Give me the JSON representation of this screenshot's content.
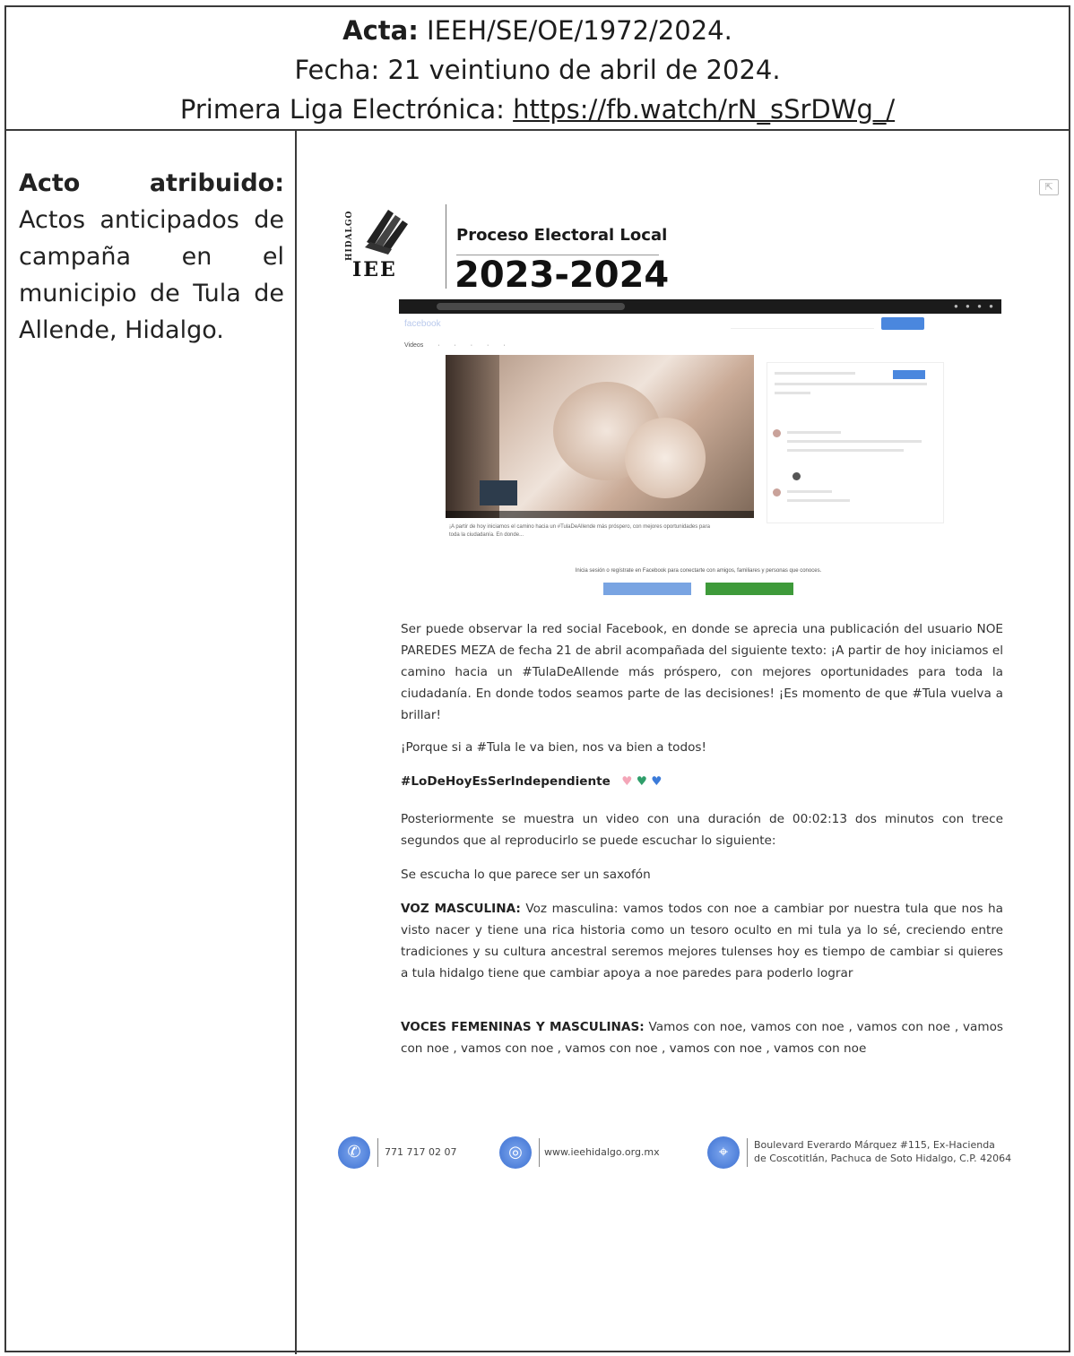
{
  "header": {
    "acta_label": "Acta:",
    "acta_value": "IEEH/SE/OE/1972/2024.",
    "fecha": "Fecha: 21 veintiuno de abril de 2024.",
    "liga_label": "Primera Liga Electrónica:",
    "liga_url": "https://fb.watch/rN_sSrDWg_/"
  },
  "left": {
    "label_word1": "Acto",
    "label_word2": "atribuido:",
    "description": "Actos anticipados de campaña en el municipio de Tula de Allende, Hidalgo."
  },
  "letterhead": {
    "logo_vertical": "HIDALGO",
    "logo_text": "IEE",
    "title": "Proceso Electoral Local",
    "year": "2023-2024"
  },
  "facebook_capture": {
    "brand": "facebook",
    "tabs": "Videos · · · · ·",
    "caption": "¡A partir de hoy iniciamos el camino hacia un #TulaDeAllende más próspero, con mejores oportunidades para toda la ciudadanía. En donde...",
    "banner": "Inicia sesión o regístrate en Facebook para conectarte con amigos, familiares y personas que conoces."
  },
  "body": {
    "p1": "Ser puede observar la red social Facebook, en donde se aprecia una publicación del usuario NOE PAREDES MEZA de fecha 21 de abril acompañada del siguiente texto: ¡A partir de hoy iniciamos el camino hacia un #TulaDeAllende más próspero, con mejores oportunidades para toda la ciudadanía. En donde todos seamos parte de las decisiones! ¡Es momento de que #Tula vuelva a brillar!",
    "p2": "¡Porque si a #Tula le va bien, nos va bien a todos!",
    "p3": "#LoDeHoyEsSerIndependiente",
    "p4": "Posteriormente se muestra un video con una duración de 00:02:13 dos minutos con trece segundos que al reproducirlo se puede escuchar lo siguiente:",
    "p5": "Se escucha lo que parece ser un saxofón",
    "p6_label": "VOZ MASCULINA:",
    "p6": "Voz masculina: vamos todos con noe a cambiar por nuestra tula que nos ha visto nacer y tiene una rica historia como un tesoro oculto en mi tula ya lo sé, creciendo entre tradiciones y su cultura ancestral seremos mejores tulenses hoy es tiempo de cambiar si quieres a tula hidalgo tiene que cambiar apoya a noe paredes para poderlo lograr",
    "p7_label": "VOCES FEMENINAS Y MASCULINAS:",
    "p7": "Vamos con noe, vamos con noe , vamos con noe , vamos con noe , vamos con noe , vamos con noe , vamos con noe , vamos con noe"
  },
  "footer": {
    "phone": "771 717 02 07",
    "web": "www.ieehidalgo.org.mx",
    "address_line1": "Boulevard Everardo Márquez #115, Ex-Hacienda",
    "address_line2": "de Coscotitlán, Pachuca de Soto Hidalgo, C.P. 42064"
  },
  "icons": [
    "phone-icon",
    "globe-icon",
    "location-icon",
    "share-icon",
    "heart-icons"
  ]
}
